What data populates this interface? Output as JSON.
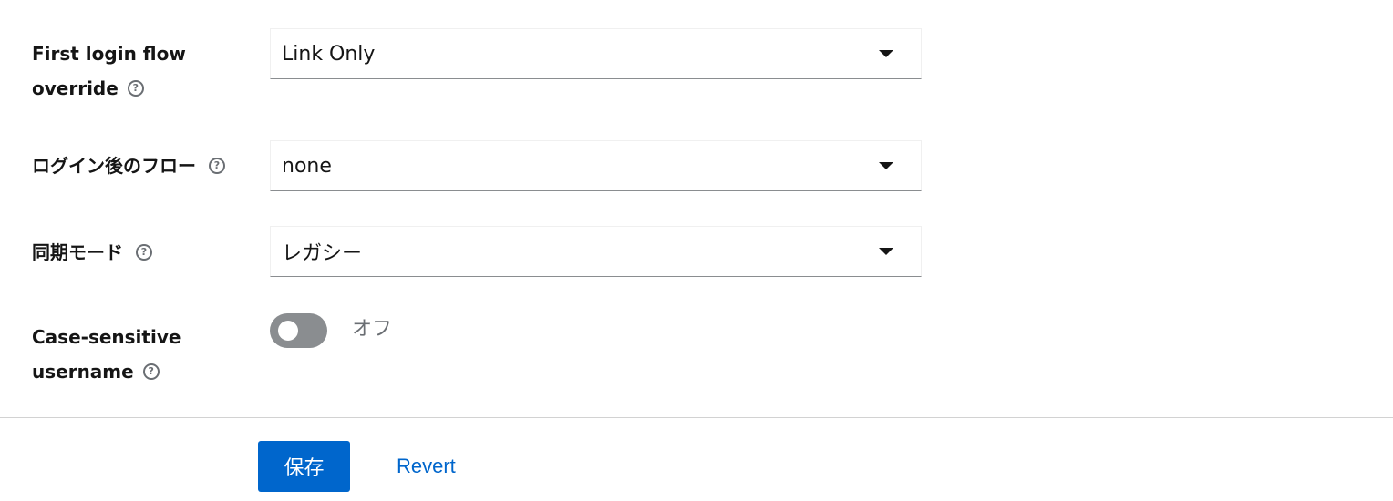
{
  "form": {
    "first_login_flow": {
      "label_line1": "First login flow",
      "label_line2": "override",
      "value": "Link Only"
    },
    "post_login_flow": {
      "label": "ログイン後のフロー",
      "value": "none"
    },
    "sync_mode": {
      "label": "同期モード",
      "value": "レガシー"
    },
    "case_sensitive": {
      "label_line1": "Case-sensitive",
      "label_line2": "username",
      "state_text": "オフ",
      "checked": false
    }
  },
  "actions": {
    "save_label": "保存",
    "revert_label": "Revert"
  },
  "colors": {
    "primary": "#0066cc",
    "toggle_off": "#8a8d90",
    "help_icon": "#6a6e73"
  },
  "icons": {
    "help": "question-circle-icon",
    "dropdown": "caret-down-icon"
  }
}
